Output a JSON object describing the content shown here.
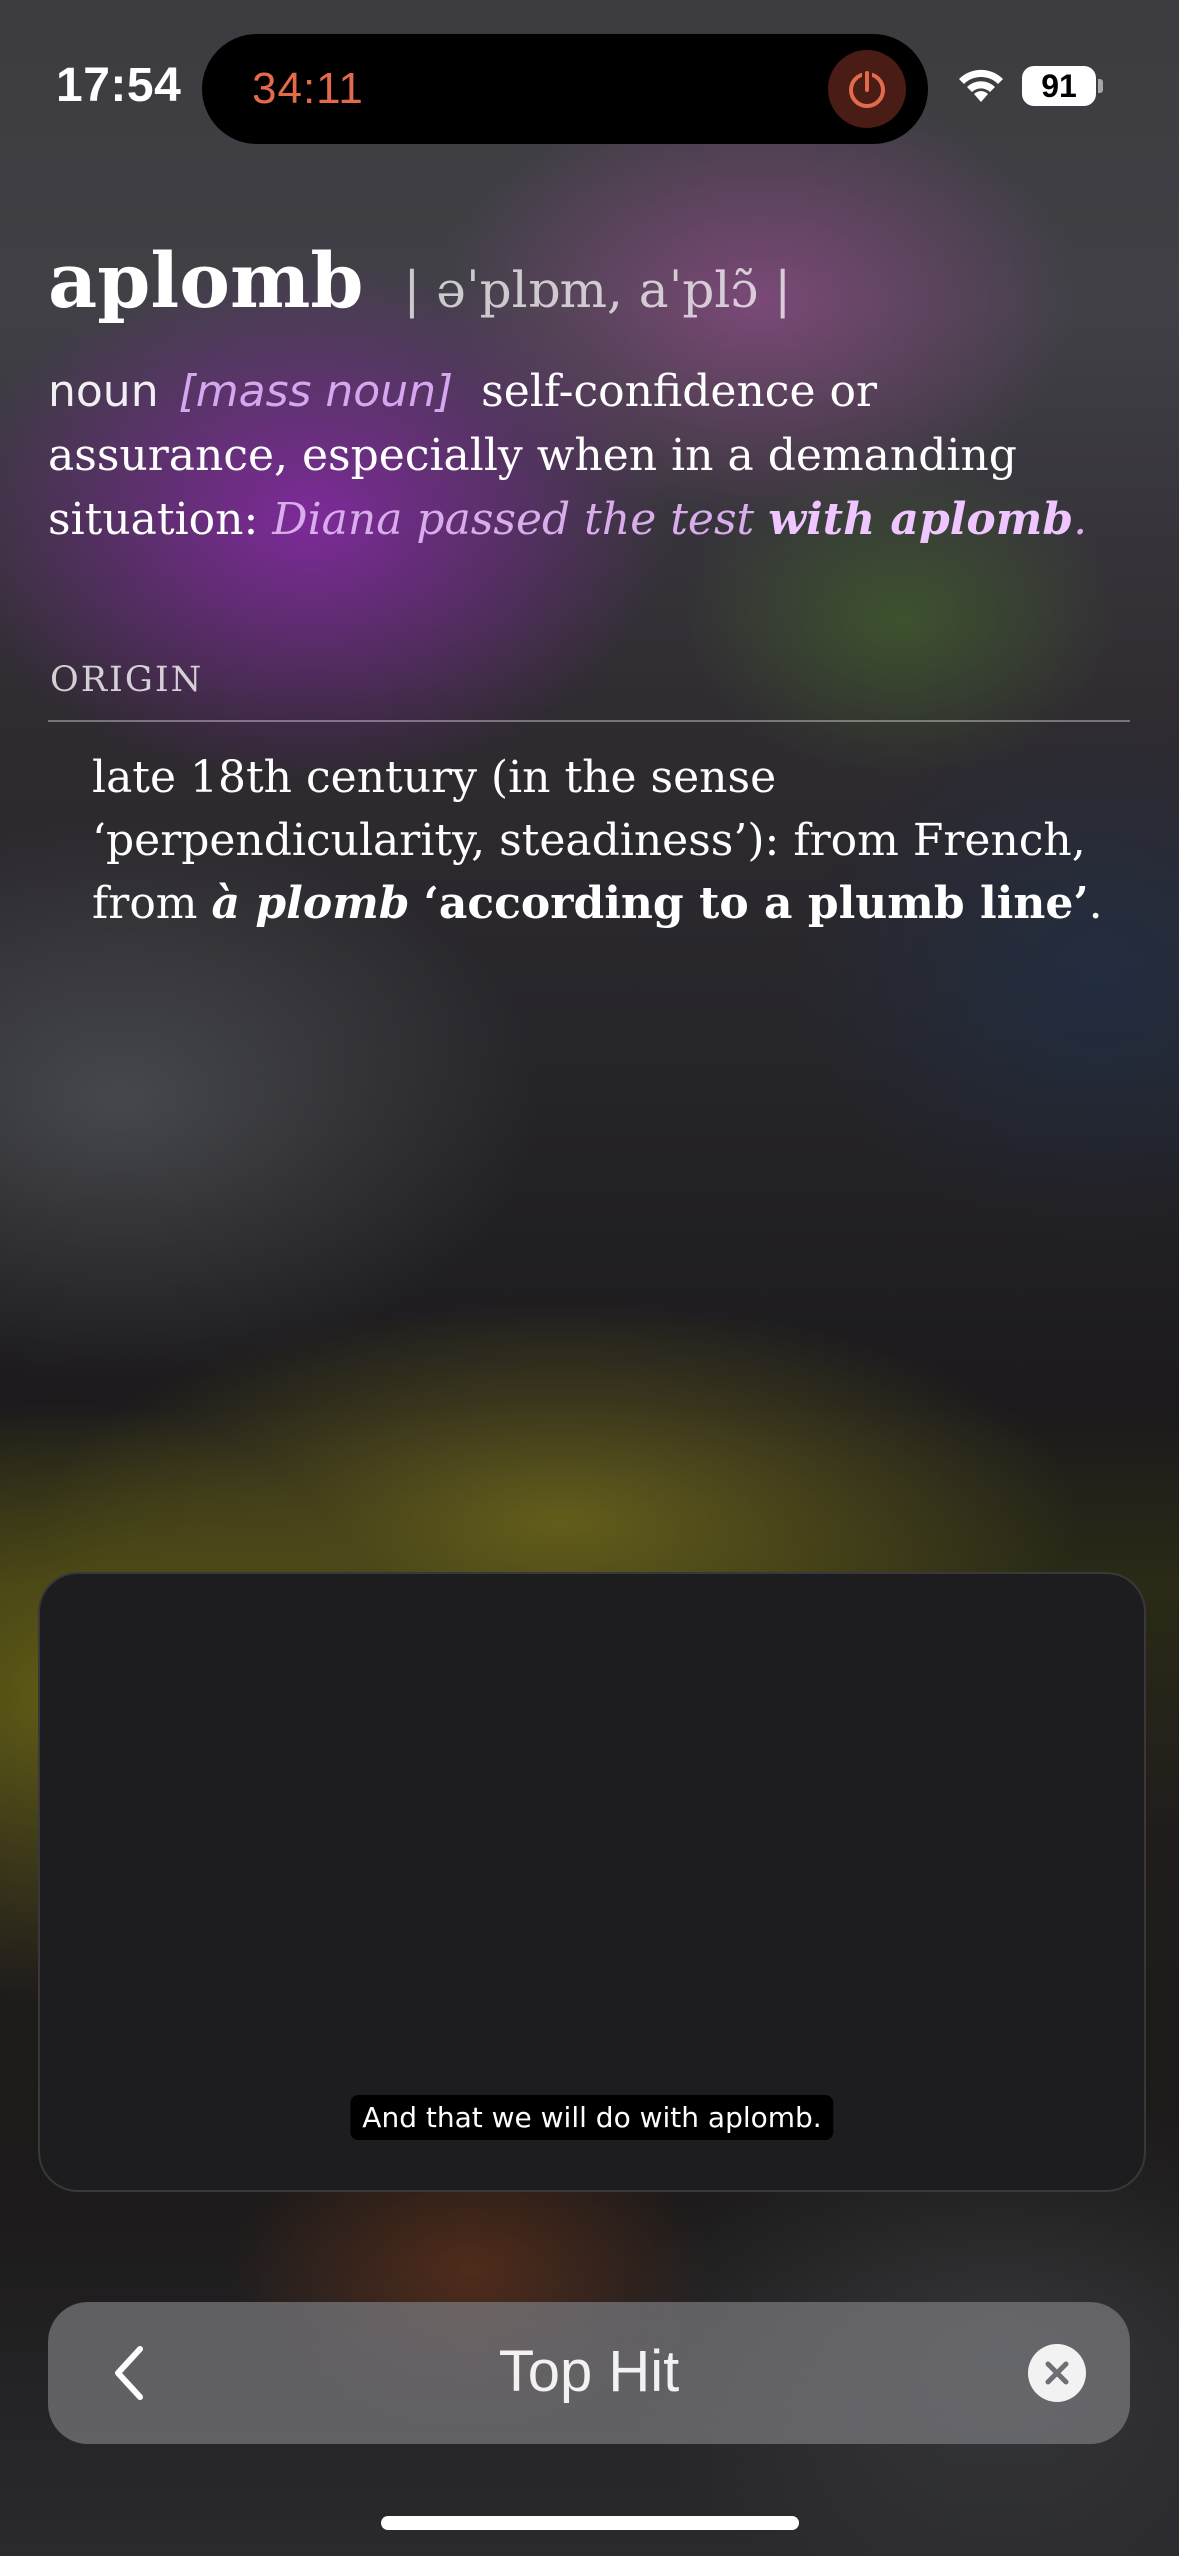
{
  "status_bar": {
    "time": "17:54",
    "timer": "34:11",
    "battery": "91",
    "icons": [
      "stop-recording-icon",
      "wifi-icon",
      "battery-icon"
    ]
  },
  "entry": {
    "headword": "aplomb",
    "pronunciation": "| əˈplɒm, aˈplɔ̃ |",
    "part_of_speech": "noun",
    "grammar": "[mass noun]",
    "definition": "self-confidence or assurance, especially when in a demanding situation: ",
    "example_start": "Diana passed the test ",
    "example_highlight": "with aplomb",
    "example_end": "."
  },
  "origin": {
    "label": "ORIGIN",
    "text_start": "late 18th century (in the sense ‘perpendicularity, steadiness’): from French, from ",
    "foreign_word": "à plomb",
    "gloss": "‘according to a plumb line’",
    "text_end": "."
  },
  "video": {
    "caption": "And that we will do with aplomb."
  },
  "search_bar": {
    "title": "Top Hit",
    "icons": [
      "chevron-left-icon",
      "clear-icon"
    ]
  },
  "colors": {
    "timer_red": "#e46a4c",
    "example_purple": "#d9acec",
    "panel_background": "#1d1d1f"
  }
}
